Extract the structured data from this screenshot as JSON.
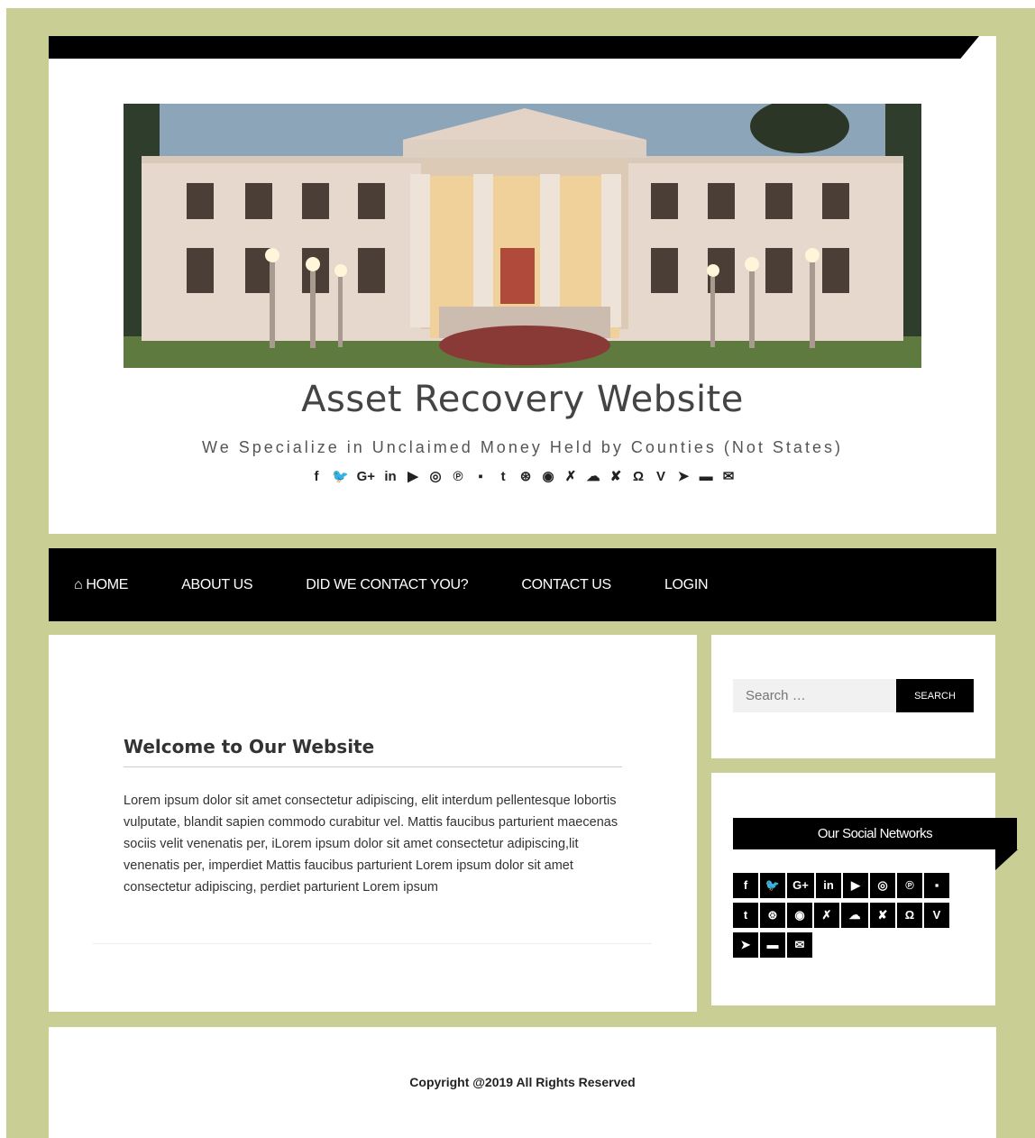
{
  "header": {
    "title": "Asset Recovery Website",
    "tagline": "We Specialize in Unclaimed Money Held by Counties (Not States)",
    "hero_image": "courthouse-building",
    "social_icons": [
      {
        "name": "facebook-icon",
        "glyph": "f"
      },
      {
        "name": "twitter-icon",
        "glyph": "🐦"
      },
      {
        "name": "google-plus-icon",
        "glyph": "G+"
      },
      {
        "name": "linkedin-icon",
        "glyph": "in"
      },
      {
        "name": "youtube-icon",
        "glyph": "▶"
      },
      {
        "name": "instagram-icon",
        "glyph": "◎"
      },
      {
        "name": "pinterest-icon",
        "glyph": "℗"
      },
      {
        "name": "flickr-icon",
        "glyph": "▪"
      },
      {
        "name": "tumblr-icon",
        "glyph": "t"
      },
      {
        "name": "dribbble-icon",
        "glyph": "⊛"
      },
      {
        "name": "reddit-icon",
        "glyph": "◉"
      },
      {
        "name": "stumbleupon-icon",
        "glyph": "✗"
      },
      {
        "name": "soundcloud-icon",
        "glyph": "☁"
      },
      {
        "name": "xing-icon",
        "glyph": "✘"
      },
      {
        "name": "github-icon",
        "glyph": "Ω"
      },
      {
        "name": "vine-icon",
        "glyph": "V"
      },
      {
        "name": "telegram-icon",
        "glyph": "➤"
      },
      {
        "name": "vk-icon",
        "glyph": "▬"
      },
      {
        "name": "email-icon",
        "glyph": "✉"
      }
    ]
  },
  "nav": {
    "items": [
      {
        "name": "nav-home",
        "label": "HOME",
        "has_icon": true
      },
      {
        "name": "nav-about-us",
        "label": "ABOUT US"
      },
      {
        "name": "nav-did-we-contact-you",
        "label": "DID WE CONTACT YOU?"
      },
      {
        "name": "nav-contact-us",
        "label": "CONTACT US"
      },
      {
        "name": "nav-login",
        "label": "LOGIN"
      }
    ]
  },
  "main": {
    "post_title": "Welcome to Our Website",
    "post_body": "Lorem ipsum dolor sit amet consectetur adipiscing, elit interdum pellentesque lobortis vulputate, blandit sapien commodo curabitur vel. Mattis faucibus parturient maecenas sociis velit venenatis per, iLorem ipsum dolor sit amet consectetur adipiscing,lit venenatis per, imperdiet Mattis faucibus parturient Lorem ipsum dolor sit amet consectetur adipiscing, perdiet parturient Lorem ipsum"
  },
  "sidebar": {
    "search_placeholder": "Search …",
    "search_button": "SEARCH",
    "social_title": "Our Social Networks"
  },
  "footer": {
    "copyright": "Copyright @2019 All Rights Reserved"
  },
  "colors": {
    "background": "#c9cf94",
    "card": "#ffffff",
    "nav": "#000000"
  }
}
